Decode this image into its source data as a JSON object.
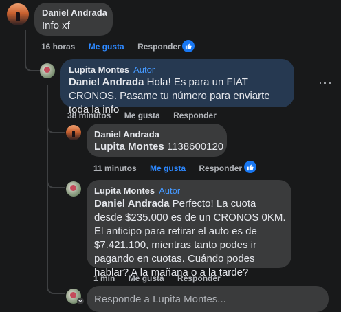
{
  "comment": {
    "author": "Daniel Andrada",
    "text": "Info xf",
    "time": "16 horas",
    "like_label": "Me gusta",
    "reply_label": "Responder",
    "icon": "like-icon"
  },
  "reply1": {
    "author": "Lupita Montes",
    "badge": "Autor",
    "mention": "Daniel Andrada",
    "text": " Hola! Es para un FIAT CRONOS. Pasame tu número para enviarte toda la info",
    "time": "38 minutos",
    "like_label": "Me gusta",
    "reply_label": "Responder",
    "more_label": "···"
  },
  "reply2": {
    "author": "Daniel Andrada",
    "mention": "Lupita Montes",
    "text": " 1138600120",
    "time": "11 minutos",
    "like_label": "Me gusta",
    "reply_label": "Responder"
  },
  "reply3": {
    "author": "Lupita Montes",
    "badge": "Autor",
    "mention": "Daniel Andrada",
    "text": " Perfecto! La cuota desde $235.000 es de un CRONOS 0KM. El anticipo para retirar el auto es de $7.421.100, mientras tanto podes ir pagando en cuotas. Cuándo podes hablar? A la mañana o a la tarde?",
    "time": "1 min",
    "like_label": "Me gusta",
    "reply_label": "Responder"
  },
  "composer": {
    "placeholder": "Responde a Lupita Montes..."
  }
}
